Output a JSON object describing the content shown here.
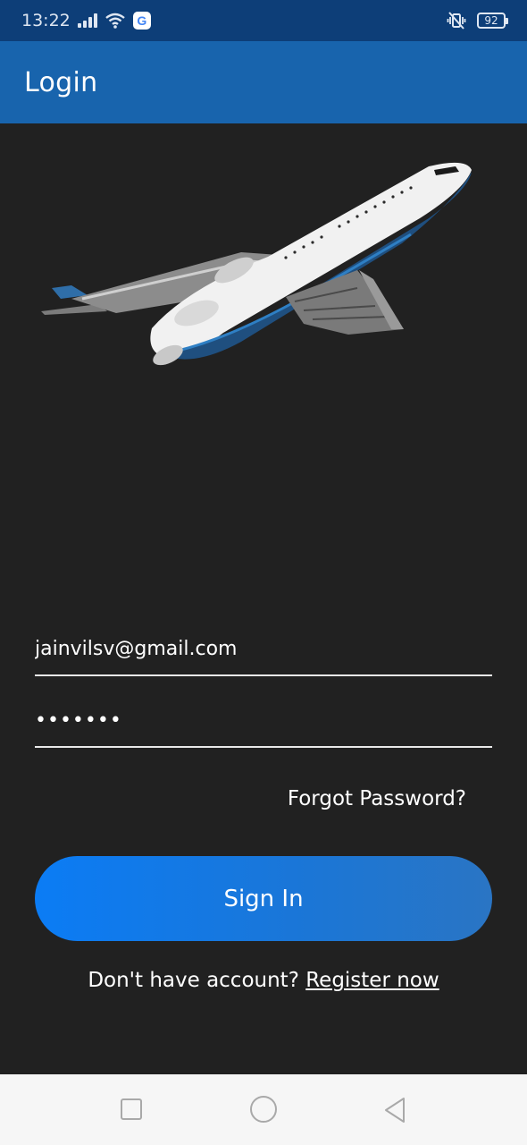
{
  "status_bar": {
    "time": "13:22",
    "battery": "92",
    "icons": [
      "signal-icon",
      "wifi-icon",
      "google-icon",
      "vibrate-icon",
      "battery-icon"
    ]
  },
  "app_bar": {
    "title": "Login",
    "color": "#1864ad"
  },
  "hero": {
    "icon": "airplane-illustration"
  },
  "login_form": {
    "email_value": "jainvilsv@gmail.com",
    "password_value": "•••••••",
    "forgot_label": "Forgot Password?",
    "sign_in_label": "Sign In",
    "register_prompt": "Don't have account? ",
    "register_link": "Register now",
    "accent": "#0b7cf5"
  },
  "nav_bar": {
    "buttons": [
      "recents-icon",
      "home-icon",
      "back-icon"
    ]
  }
}
